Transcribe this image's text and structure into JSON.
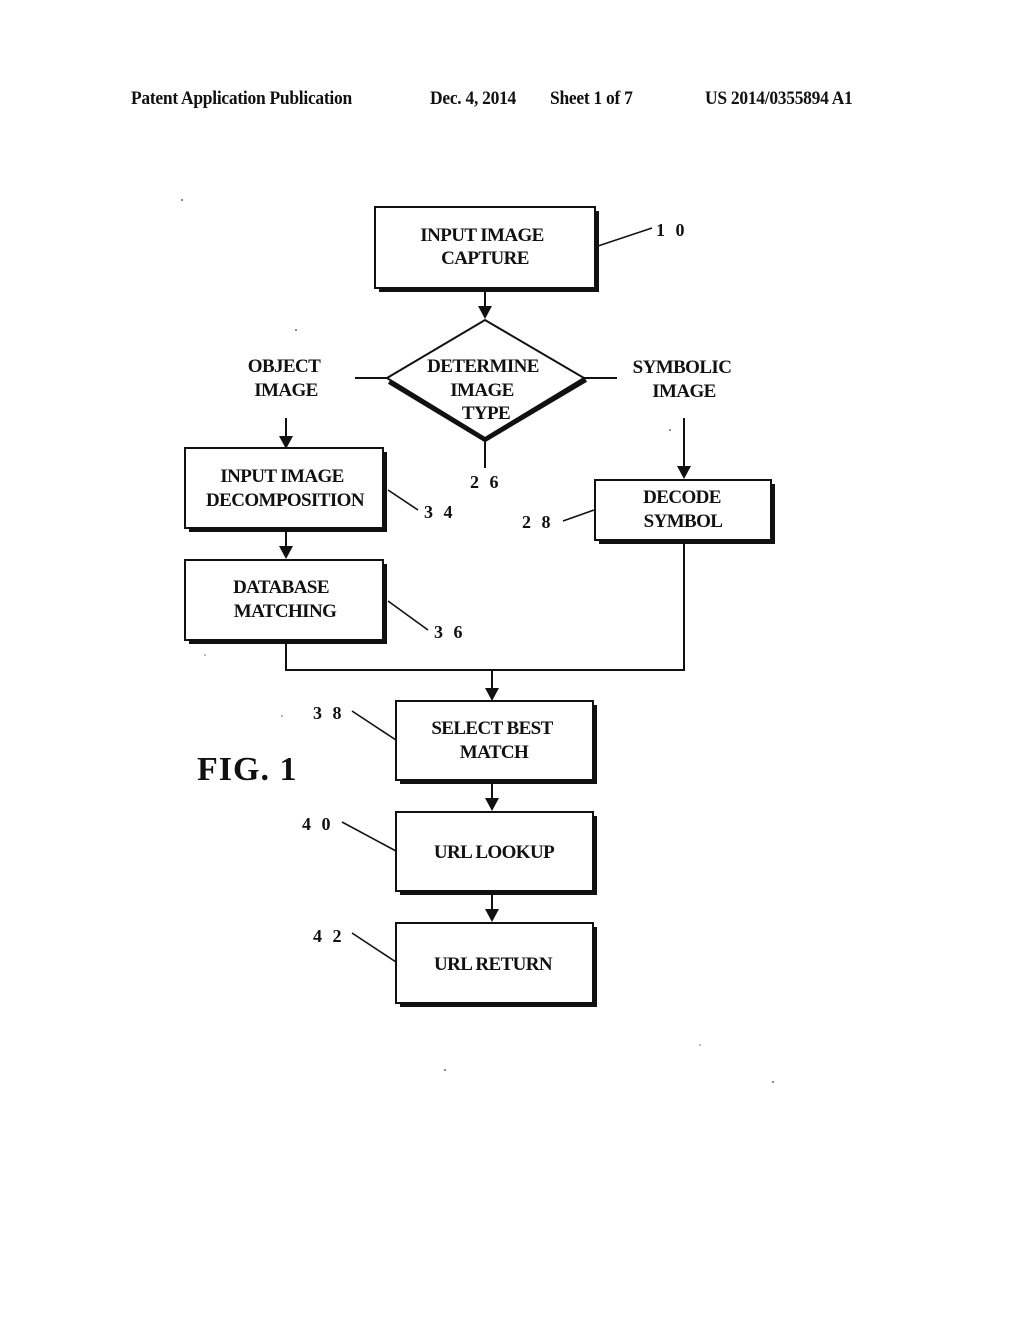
{
  "header": {
    "publication_type": "Patent Application Publication",
    "date": "Dec. 4, 2014",
    "sheet": "Sheet 1 of 7",
    "publication_number": "US 2014/0355894 A1"
  },
  "figure": {
    "label": "FIG. 1"
  },
  "flowchart": {
    "nodes": {
      "input_capture": {
        "lines": [
          "INPUT IMAGE",
          "CAPTURE"
        ],
        "ref": "1 0"
      },
      "determine_type": {
        "lines": [
          "DETERMINE",
          "IMAGE",
          "TYPE"
        ],
        "ref": "2 6"
      },
      "decomposition": {
        "lines": [
          "INPUT IMAGE",
          "DECOMPOSITION"
        ],
        "ref": "3 4"
      },
      "database_matching": {
        "lines": [
          "DATABASE",
          "MATCHING"
        ],
        "ref": "3 6"
      },
      "decode_symbol": {
        "lines": [
          "DECODE",
          "SYMBOL"
        ],
        "ref": "2 8"
      },
      "select_best": {
        "lines": [
          "SELECT BEST",
          "MATCH"
        ],
        "ref": "3 8"
      },
      "url_lookup": {
        "lines": [
          "URL LOOKUP"
        ],
        "ref": "4 0"
      },
      "url_return": {
        "lines": [
          "URL RETURN"
        ],
        "ref": "4 2"
      }
    },
    "branches": {
      "left": [
        "OBJECT",
        "IMAGE"
      ],
      "right": [
        "SYMBOLIC",
        "IMAGE"
      ]
    },
    "edges": [
      {
        "from": "input_capture",
        "to": "determine_type"
      },
      {
        "from": "determine_type",
        "to": "decomposition",
        "label": "OBJECT IMAGE"
      },
      {
        "from": "determine_type",
        "to": "decode_symbol",
        "label": "SYMBOLIC IMAGE"
      },
      {
        "from": "decomposition",
        "to": "database_matching"
      },
      {
        "from": "database_matching",
        "to": "select_best"
      },
      {
        "from": "decode_symbol",
        "to": "select_best"
      },
      {
        "from": "select_best",
        "to": "url_lookup"
      },
      {
        "from": "url_lookup",
        "to": "url_return"
      }
    ]
  }
}
